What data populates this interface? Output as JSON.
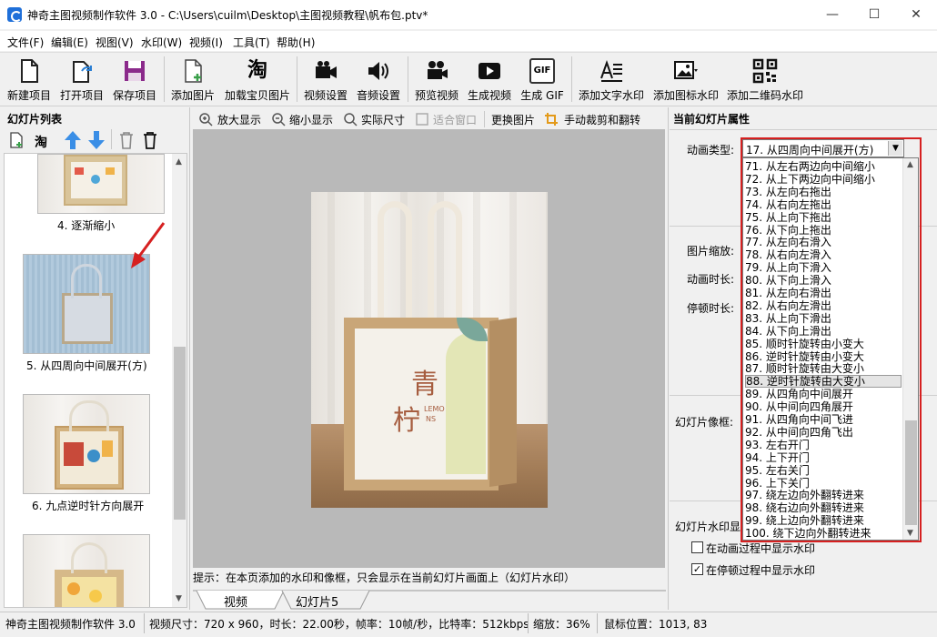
{
  "window": {
    "title": "神奇主图视频制作软件 3.0 - C:\\Users\\cuilm\\Desktop\\主图视频教程\\帆布包.ptv*",
    "minimize": "—",
    "maximize": "☐",
    "close": "✕"
  },
  "menu": [
    "文件(F)",
    "编辑(E)",
    "视图(V)",
    "水印(W)",
    "视频(I)",
    "工具(T)",
    "帮助(H)"
  ],
  "toolbar": [
    {
      "label": "新建项目",
      "icon": "new-file-icon"
    },
    {
      "label": "打开项目",
      "icon": "open-project-icon"
    },
    {
      "label": "保存项目",
      "icon": "save-icon"
    },
    {
      "label": "添加图片",
      "icon": "add-image-icon"
    },
    {
      "label": "加载宝贝图片",
      "icon": "taobao-icon",
      "glyph": "淘"
    },
    {
      "label": "视频设置",
      "icon": "video-camera-icon"
    },
    {
      "label": "音频设置",
      "icon": "speaker-icon"
    },
    {
      "label": "预览视频",
      "icon": "movie-camera-icon"
    },
    {
      "label": "生成视频",
      "icon": "play-video-icon"
    },
    {
      "label": "生成 GIF",
      "icon": "gif-icon",
      "glyph": "GIF"
    },
    {
      "label": "添加文字水印",
      "icon": "text-watermark-icon"
    },
    {
      "label": "添加图标水印",
      "icon": "image-watermark-icon"
    },
    {
      "label": "添加二维码水印",
      "icon": "qrcode-icon"
    }
  ],
  "left_pane": {
    "title": "幻灯片列表",
    "toolbar_icons": [
      "add-slide-icon",
      "taobao-icon",
      "move-up-icon",
      "move-down-icon",
      "delete-icon",
      "clear-icon"
    ],
    "taobao_glyph": "淘",
    "slides": [
      {
        "label": "4. 逐渐缩小"
      },
      {
        "label": "5. 从四周向中间展开(方)"
      },
      {
        "label": "6. 九点逆时针方向展开"
      },
      {
        "label": ""
      }
    ]
  },
  "center_pane": {
    "tools": [
      "放大显示",
      "缩小显示",
      "实际尺寸",
      "适合窗口",
      "更换图片",
      "手动裁剪和翻转"
    ],
    "preview": {
      "bag_text_main": "青",
      "bag_text_second": "柠",
      "bag_text_small_1": "LEMO",
      "bag_text_small_2": "NS"
    },
    "hint": "提示：在本页添加的水印和像框，只会显示在当前幻灯片画面上（幻灯片水印）",
    "tabs": [
      "视频",
      "幻灯片5"
    ]
  },
  "right_pane": {
    "title": "当前幻灯片属性",
    "anim_type_label": "动画类型:",
    "anim_type_value": "17. 从四周向中间展开(方)",
    "image_scale_label": "图片缩放:",
    "anim_duration_label": "动画时长:",
    "pause_duration_label": "停顿时长:",
    "frame_label": "幻灯片像框:",
    "watermark_label": "幻灯片水印显",
    "checkbox_anim": {
      "label": "在动画过程中显示水印",
      "checked": false
    },
    "checkbox_pause": {
      "label": "在停顿过程中显示水印",
      "checked": true,
      "mark": "✓"
    },
    "dropdown_items": [
      "71. 从左右两边向中间缩小",
      "72. 从上下两边向中间缩小",
      "73. 从左向右拖出",
      "74. 从右向左拖出",
      "75. 从上向下拖出",
      "76. 从下向上拖出",
      "77. 从左向右滑入",
      "78. 从右向左滑入",
      "79. 从上向下滑入",
      "80. 从下向上滑入",
      "81. 从左向右滑出",
      "82. 从右向左滑出",
      "83. 从上向下滑出",
      "84. 从下向上滑出",
      "85. 顺时针旋转由小变大",
      "86. 逆时针旋转由小变大",
      "87. 顺时针旋转由大变小",
      "88. 逆时针旋转由大变小",
      "89. 从四角向中间展开",
      "90. 从中间向四角展开",
      "91. 从四角向中间飞进",
      "92. 从中间向四角飞出",
      "93. 左右开门",
      "94. 上下开门",
      "95. 左右关门",
      "96. 上下关门",
      "97. 绕左边向外翻转进来",
      "98. 绕右边向外翻转进来",
      "99. 绕上边向外翻转进来",
      "100. 绕下边向外翻转进来"
    ],
    "highlighted_item": "88. 逆时针旋转由大变小"
  },
  "status": {
    "app": "神奇主图视频制作软件 3.0",
    "video_info": "视频尺寸：720 x 960，时长：22.00秒，帧率：10帧/秒，比特率：512kbps",
    "zoom": "缩放：36%",
    "mouse": "鼠标位置：1013, 83"
  },
  "colors": {
    "accent_red": "#d62020",
    "arrow_blue": "#3a8ee6",
    "icon_purple": "#8b2a8b"
  }
}
